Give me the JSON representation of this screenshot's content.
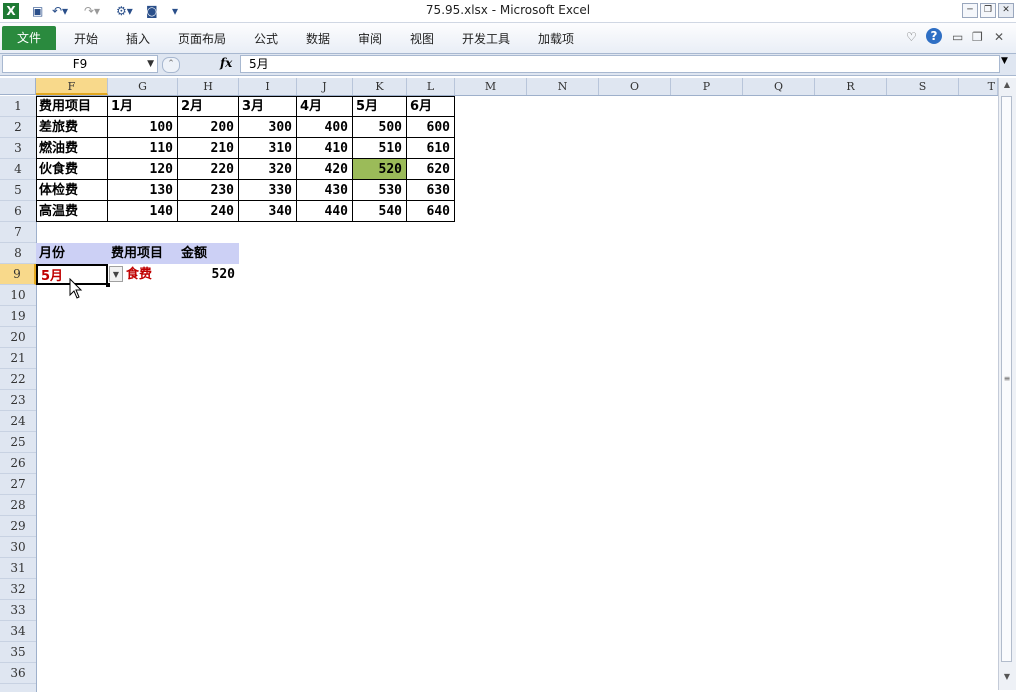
{
  "window": {
    "title": "75.95.xlsx  -  Microsoft Excel",
    "app_icon": "excel-icon"
  },
  "quick_access": [
    "save-icon",
    "undo-icon",
    "redo-icon",
    "customize-icon"
  ],
  "ribbon": {
    "file_tab": "文件",
    "tabs": [
      "开始",
      "插入",
      "页面布局",
      "公式",
      "数据",
      "审阅",
      "视图",
      "开发工具",
      "加载项"
    ]
  },
  "formula_bar": {
    "name_box": "F9",
    "fx_label": "fx",
    "content": "5月"
  },
  "columns": [
    "F",
    "G",
    "H",
    "I",
    "J",
    "K",
    "L",
    "M",
    "N",
    "O",
    "P",
    "Q",
    "R",
    "S",
    "T"
  ],
  "rows": [
    "1",
    "2",
    "3",
    "4",
    "5",
    "6",
    "7",
    "8",
    "9",
    "10",
    "19",
    "20",
    "21",
    "22",
    "23",
    "24",
    "25",
    "26",
    "27",
    "28",
    "29",
    "30",
    "31",
    "32",
    "33",
    "34",
    "35",
    "36"
  ],
  "sheet": {
    "header": [
      "费用项目",
      "1月",
      "2月",
      "3月",
      "4月",
      "5月",
      "6月"
    ],
    "data": [
      [
        "差旅费",
        "100",
        "200",
        "300",
        "400",
        "500",
        "600"
      ],
      [
        "燃油费",
        "110",
        "210",
        "310",
        "410",
        "510",
        "610"
      ],
      [
        "伙食费",
        "120",
        "220",
        "320",
        "420",
        "520",
        "620"
      ],
      [
        "体检费",
        "130",
        "230",
        "330",
        "430",
        "530",
        "630"
      ],
      [
        "高温费",
        "140",
        "240",
        "340",
        "440",
        "540",
        "640"
      ]
    ],
    "lookup_header": [
      "月份",
      "费用项目",
      "金额"
    ],
    "lookup_values": {
      "month": "5月",
      "item": "食费",
      "amount": "520"
    }
  },
  "colors": {
    "highlight": "#9bbb59",
    "red_text": "#c00000",
    "selected_header": "#f8d98b",
    "file_tab": "#2a8a3e"
  }
}
